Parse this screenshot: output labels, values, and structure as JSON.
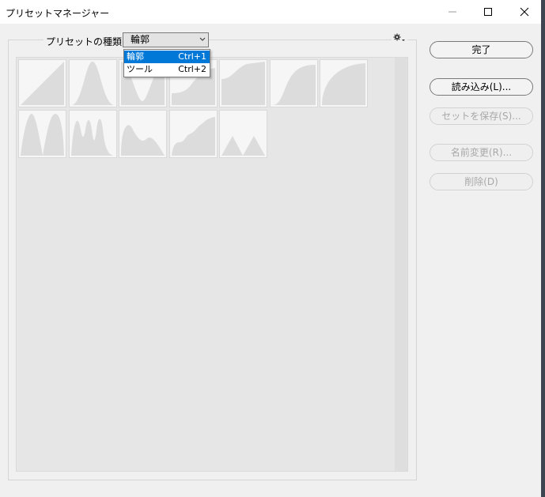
{
  "window": {
    "title": "プリセットマネージャー"
  },
  "preset_type": {
    "label": "プリセットの種類 :",
    "selected": "輪郭"
  },
  "dropdown": {
    "items": [
      {
        "label": "輪郭",
        "shortcut": "Ctrl+1",
        "highlighted": true
      },
      {
        "label": "ツール",
        "shortcut": "Ctrl+2",
        "highlighted": false
      }
    ]
  },
  "buttons": {
    "done": "完了",
    "load": "読み込み(L)...",
    "save": "セットを保存(S)...",
    "rename": "名前変更(R)...",
    "delete": "削除(D)"
  },
  "presets": [
    {
      "icon": "linear-contour"
    },
    {
      "icon": "cone-contour"
    },
    {
      "icon": "cone-inverted-contour"
    },
    {
      "icon": "cove-deep-contour"
    },
    {
      "icon": "cove-shallow-contour"
    },
    {
      "icon": "gaussian-contour"
    },
    {
      "icon": "half-round-contour"
    },
    {
      "icon": "ring-contour"
    },
    {
      "icon": "ring-double-contour"
    },
    {
      "icon": "rolling-slope-contour"
    },
    {
      "icon": "rounded-steps-contour"
    },
    {
      "icon": "sawtooth-contour"
    }
  ],
  "colors": {
    "selection": "#0078d7",
    "curve_fill": "#dcdcdc",
    "panel": "#e6e6e6"
  }
}
